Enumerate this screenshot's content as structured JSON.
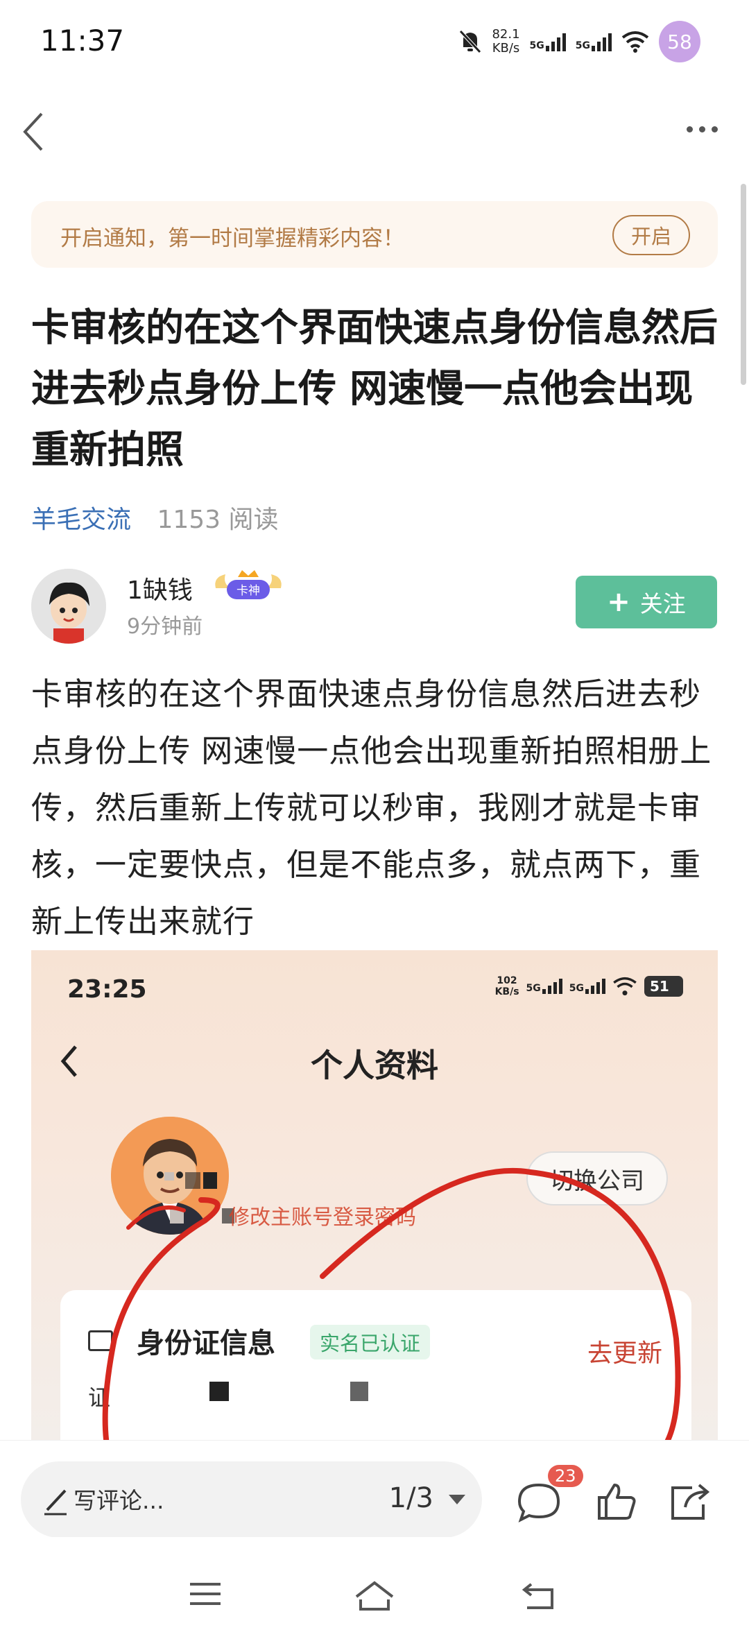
{
  "status_bar": {
    "time": "11:37",
    "net_speed_value": "82.1",
    "net_speed_unit": "KB/s",
    "sim1": "5G",
    "sim2": "5G",
    "battery": "58"
  },
  "notice": {
    "text": "开启通知，第一时间掌握精彩内容！",
    "button": "开启"
  },
  "article": {
    "title": "卡审核的在这个界面快速点身份信息然后进去秒点身份上传 网速慢一点他会出现重新拍照",
    "category": "羊毛交流",
    "reads": "1153 阅读",
    "author_name": "1缺钱",
    "author_badge": "卡神",
    "post_time": "9分钟前",
    "follow_label": "关注",
    "body": "卡审核的在这个界面快速点身份信息然后进去秒点身份上传 网速慢一点他会出现重新拍照相册上传，然后重新上传就可以秒审，我刚才就是卡审核，一定要快点，但是不能点多，就点两下，重新上传出来就行"
  },
  "embedded_screenshot": {
    "time": "23:25",
    "net_speed_value": "102",
    "net_speed_unit": "KB/s",
    "sim1": "5G",
    "sim2": "5G",
    "battery": "51",
    "page_title": "个人资料",
    "switch_company": "切换公司",
    "change_password": "修改主账号登录密码",
    "id_info": "身份证信息",
    "verified": "实名已认证",
    "update": "去更新",
    "cert_prefix": "证"
  },
  "bottom_bar": {
    "comment_placeholder": "写评论...",
    "pager": "1/3",
    "comment_count": "23"
  }
}
